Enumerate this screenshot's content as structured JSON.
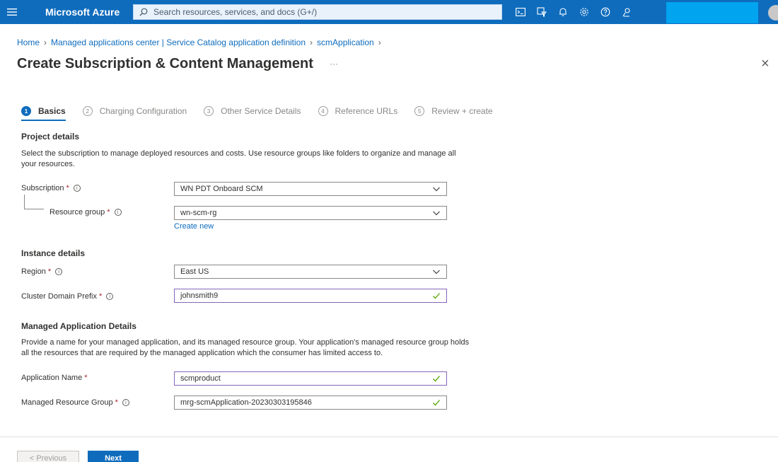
{
  "topbar": {
    "brand": "Microsoft Azure",
    "search_placeholder": "Search resources, services, and docs (G+/)",
    "icons": [
      "cloud-shell-icon",
      "directory-filter-icon",
      "notifications-icon",
      "settings-icon",
      "help-icon",
      "feedback-icon"
    ],
    "accent": "#0f6cbd"
  },
  "breadcrumb": {
    "items": [
      "Home",
      "Managed applications center | Service Catalog application definition",
      "scmApplication"
    ]
  },
  "page": {
    "title": "Create Subscription & Content Management",
    "ellipsis": "···",
    "close": "×"
  },
  "steps": [
    {
      "num": "1",
      "label": "Basics"
    },
    {
      "num": "2",
      "label": "Charging Configuration"
    },
    {
      "num": "3",
      "label": "Other Service Details"
    },
    {
      "num": "4",
      "label": "Reference URLs"
    },
    {
      "num": "5",
      "label": "Review + create"
    }
  ],
  "project": {
    "title": "Project details",
    "desc": "Select the subscription to manage deployed resources and costs. Use resource groups like folders to organize and manage all your resources.",
    "subscription_label": "Subscription",
    "subscription_value": "WN PDT Onboard SCM",
    "resource_group_label": "Resource group",
    "resource_group_value": "wn-scm-rg",
    "create_new": "Create new"
  },
  "instance": {
    "title": "Instance details",
    "region_label": "Region",
    "region_value": "East US",
    "prefix_label": "Cluster Domain Prefix",
    "prefix_value": "johnsmith9"
  },
  "managed": {
    "title": "Managed Application Details",
    "desc": "Provide a name for your managed application, and its managed resource group. Your application's managed resource group holds all the resources that are required by the managed application which the consumer has limited access to.",
    "app_name_label": "Application Name",
    "app_name_value": "scmproduct",
    "mrg_label": "Managed Resource Group",
    "mrg_value": "mrg-scmApplication-20230303195846"
  },
  "required_mark": "*",
  "info_mark": "i",
  "footer": {
    "previous": "< Previous",
    "next": "Next"
  }
}
